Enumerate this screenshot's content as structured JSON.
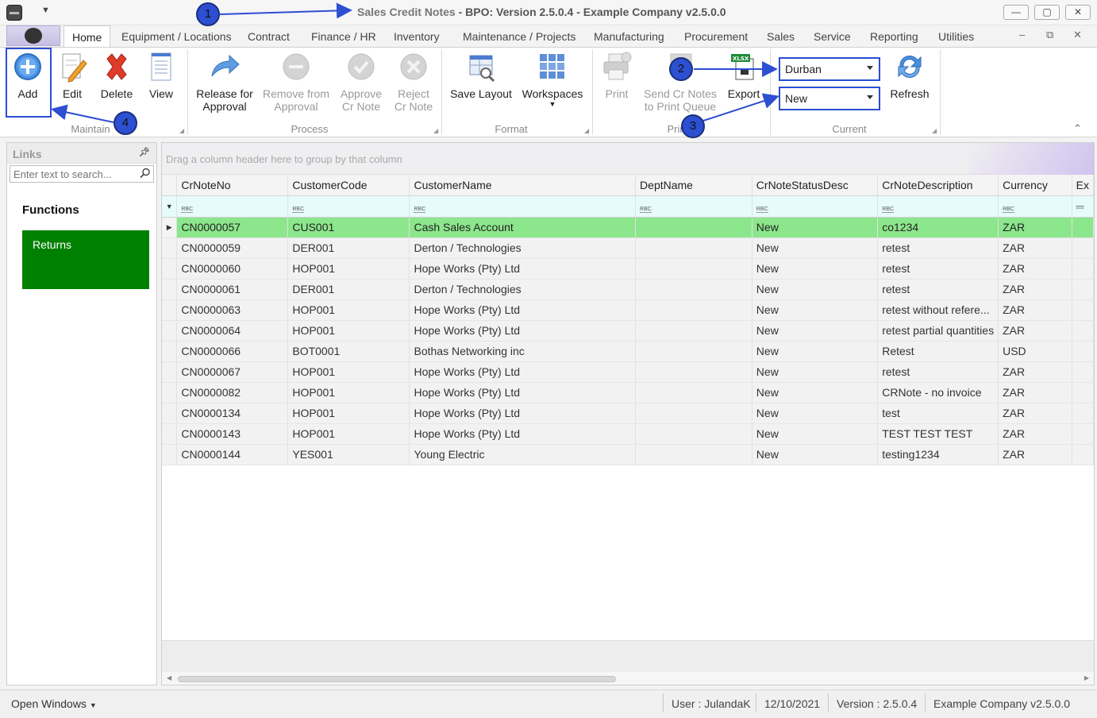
{
  "window": {
    "title_main": "Sales Credit Notes",
    "title_rest": " - BPO: Version 2.5.0.4 - Example Company v2.5.0.0",
    "minimize": "—",
    "maximize": "▢",
    "close": "✕"
  },
  "tabs": [
    "Home",
    "Equipment / Locations",
    "Contract",
    "Finance / HR",
    "Inventory",
    "Maintenance / Projects",
    "Manufacturing",
    "Procurement",
    "Sales",
    "Service",
    "Reporting",
    "Utilities"
  ],
  "tab_controls": {
    "minimize": "–",
    "restore": "⧉",
    "close": "✕"
  },
  "ribbon": {
    "maintain": {
      "label": "Maintain",
      "add": "Add",
      "edit": "Edit",
      "delete": "Delete",
      "view": "View"
    },
    "process": {
      "label": "Process",
      "release_1": "Release for",
      "release_2": "Approval",
      "remove_1": "Remove from",
      "remove_2": "Approval",
      "approve_1": "Approve",
      "approve_2": "Cr Note",
      "reject_1": "Reject",
      "reject_2": "Cr Note"
    },
    "format": {
      "label": "Format",
      "save_layout": "Save Layout",
      "workspaces": "Workspaces"
    },
    "print": {
      "label": "Prin",
      "print": "Print",
      "send_1": "Send Cr Notes",
      "send_2": "to Print Queue",
      "export": "Export",
      "xlsx": "XLSX"
    },
    "current": {
      "label": "Current",
      "site": "Durban",
      "status": "New",
      "refresh": "Refresh"
    }
  },
  "links": {
    "title": "Links",
    "search_placeholder": "Enter text to search...",
    "functions_title": "Functions",
    "returns": "Returns"
  },
  "grid": {
    "group_hint": "Drag a column header here to group by that column",
    "filter_glyph": "RBC",
    "columns": [
      "CrNoteNo",
      "CustomerCode",
      "CustomerName",
      "DeptName",
      "CrNoteStatusDesc",
      "CrNoteDescription",
      "Currency",
      "Ex"
    ],
    "rows": [
      [
        "CN0000057",
        "CUS001",
        "Cash Sales Account",
        "",
        "New",
        "co1234",
        "ZAR"
      ],
      [
        "CN0000059",
        "DER001",
        "Derton / Technologies",
        "",
        "New",
        "retest",
        "ZAR"
      ],
      [
        "CN0000060",
        "HOP001",
        "Hope Works (Pty) Ltd",
        "",
        "New",
        "retest",
        "ZAR"
      ],
      [
        "CN0000061",
        "DER001",
        "Derton / Technologies",
        "",
        "New",
        "retest",
        "ZAR"
      ],
      [
        "CN0000063",
        "HOP001",
        "Hope Works (Pty) Ltd",
        "",
        "New",
        "retest without refere...",
        "ZAR"
      ],
      [
        "CN0000064",
        "HOP001",
        "Hope Works (Pty) Ltd",
        "",
        "New",
        "retest partial quantities",
        "ZAR"
      ],
      [
        "CN0000066",
        "BOT0001",
        "Bothas Networking inc",
        "",
        "New",
        "Retest",
        "USD"
      ],
      [
        "CN0000067",
        "HOP001",
        "Hope Works (Pty) Ltd",
        "",
        "New",
        "retest",
        "ZAR"
      ],
      [
        "CN0000082",
        "HOP001",
        "Hope Works (Pty) Ltd",
        "",
        "New",
        "CRNote - no invoice",
        "ZAR"
      ],
      [
        "CN0000134",
        "HOP001",
        "Hope Works (Pty) Ltd",
        "",
        "New",
        "test",
        "ZAR"
      ],
      [
        "CN0000143",
        "HOP001",
        "Hope Works (Pty) Ltd",
        "",
        "New",
        "TEST TEST TEST",
        "ZAR"
      ],
      [
        "CN0000144",
        "YES001",
        "Young Electric",
        "",
        "New",
        "testing1234",
        "ZAR"
      ]
    ]
  },
  "status": {
    "open_windows": "Open Windows",
    "user": "User : JulandaK",
    "date": "12/10/2021",
    "version": "Version : 2.5.0.4",
    "company": "Example Company v2.5.0.0"
  },
  "annotations": [
    "1",
    "2",
    "3",
    "4"
  ],
  "colors": {
    "accent": "#2a4dd0",
    "selected_row": "#8ce68c",
    "returns_tile": "#008000"
  }
}
